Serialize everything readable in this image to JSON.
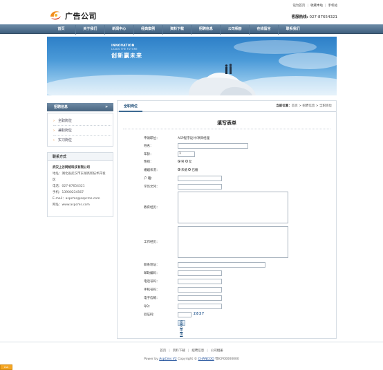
{
  "header": {
    "logo_text": "广告公司",
    "toplinks": [
      "设为首页",
      "收藏本站",
      "手机站"
    ],
    "hotline_label": "客服热线:",
    "hotline_number": "027-87654321"
  },
  "nav": {
    "items": [
      "首页",
      "关于我们",
      "新闻中心",
      "经典案例",
      "资料下载",
      "招聘信息",
      "公司相册",
      "在线留言",
      "联系我们"
    ]
  },
  "banner": {
    "line1": "INNOVATION",
    "line2": "LEADS THE FUTURE",
    "line3": "创新赢未来"
  },
  "sidebar": {
    "title": "招聘信息",
    "arrow": "»",
    "items": [
      "全职岗位",
      "兼职岗位",
      "实习岗位"
    ],
    "contact_title": "联系方式",
    "company": "武汉上谷网络科技有限公司",
    "address": "地址：湖北省武汉市东湖高新技术开发区",
    "phone": "电话：027-87654321",
    "mobile": "手机：13900234567",
    "email": "E-mail：aspcms@aspcms.com",
    "website": "网址：www.aspcms.com"
  },
  "main": {
    "tab": "全职岗位",
    "crumb_label": "当前位置：",
    "crumb_path": "首页 > 招聘信息 > 全职岗位",
    "form_title": "填写表单",
    "fields": {
      "position_label": "申请职位：",
      "position_value": "ASP程序设计/项目经理",
      "name_label": "姓名：",
      "age_label": "年龄：",
      "age_value": "1",
      "gender_label": "性别：",
      "gender_male": "男",
      "gender_female": "女",
      "marital_label": "婚姻状况：",
      "marital_single": "未婚",
      "marital_married": "已婚",
      "hukou_label": "户 籍：",
      "education_label": "学历文凭：",
      "edu_history_label": "教育经历：",
      "work_history_label": "工作经历：",
      "address_label": "联系地址：",
      "postcode_label": "邮政编码：",
      "phone_label": "电话号码：",
      "mobile_label": "手机号码：",
      "email_label": "电子信箱：",
      "qq_label": "QQ：",
      "captcha_label": "验证码：",
      "captcha_code": "2837",
      "submit_label": "提交申请"
    }
  },
  "footer": {
    "links": [
      "首页",
      "资料下载",
      "招聘信息",
      "公司相册"
    ],
    "powered_prefix": "Power by",
    "powered_link": "AspCms V2",
    "copyright": "Copyright ©",
    "copyright_link": "CHANCOO",
    "icp": "鄂ICP00000000",
    "badge": "DSN"
  },
  "colors": {
    "nav_bg": "#47647f",
    "accent": "#1f4f79",
    "bullet": "#e67817",
    "banner_sky": "#4b9ad8"
  }
}
